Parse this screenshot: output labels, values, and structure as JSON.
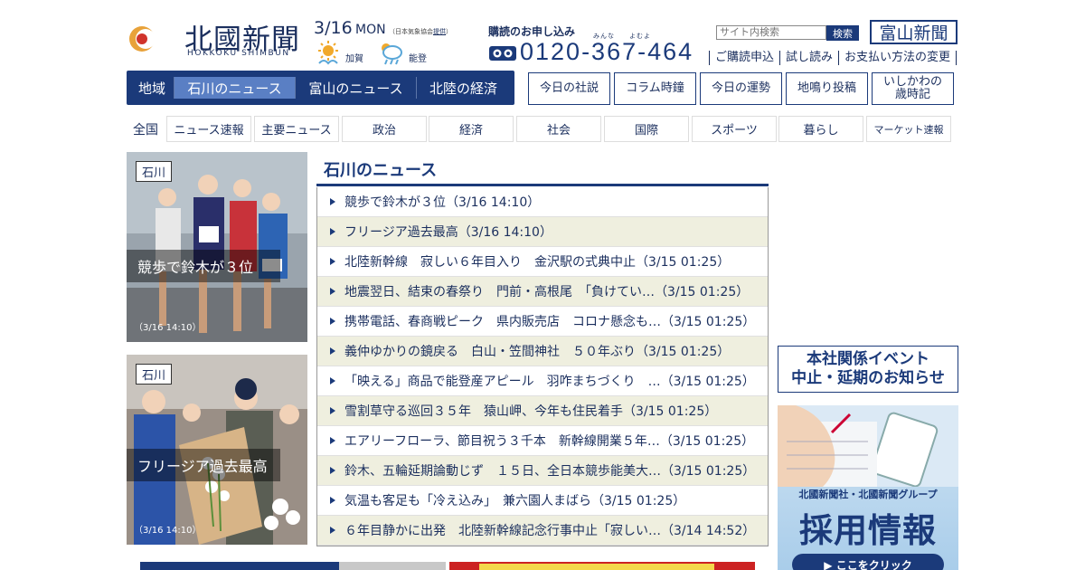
{
  "brand": {
    "name": "北國新聞",
    "name_en": "HOKKOKU SHIMBUN",
    "color": "#1b3a7a"
  },
  "weather": {
    "date": "3/16",
    "day": "MON",
    "source_prefix": "（日本気象協会",
    "source_link": "提供",
    "source_suffix": "）",
    "areas": [
      {
        "name": "加賀",
        "icon": "sun-icon"
      },
      {
        "name": "能登",
        "icon": "cloud-rain-icon"
      }
    ]
  },
  "subscribe": {
    "title": "購読のお申し込み",
    "ruby": "みんな　　よむよ",
    "phone": "0120-367-464",
    "links": [
      "ご購読申込",
      "試し読み",
      "お支払い方法の変更"
    ]
  },
  "search": {
    "placeholder": "サイト内検索",
    "button": "検索"
  },
  "toyama_logo": "富山新聞",
  "region_nav": {
    "label": "地域",
    "tabs": [
      {
        "label": "石川のニュース",
        "active": true
      },
      {
        "label": "富山のニュース",
        "active": false
      },
      {
        "label": "北陸の経済",
        "active": false
      }
    ]
  },
  "columns": [
    "今日の社説",
    "コラム時鐘",
    "今日の運勢",
    "地鳴り投稿",
    "いしかわの\n歳時記"
  ],
  "category_nav": {
    "label": "全国",
    "items": [
      "ニュース速報",
      "主要ニュース",
      "政治",
      "経済",
      "社会",
      "国際",
      "スポーツ",
      "暮らし",
      "マーケット速報"
    ]
  },
  "cards": [
    {
      "tag": "石川",
      "caption": "競歩で鈴木が３位",
      "time": "（3/16 14:10）"
    },
    {
      "tag": "石川",
      "caption": "フリージア過去最高",
      "time": "（3/16 14:10）"
    }
  ],
  "news": {
    "title": "石川のニュース",
    "items": [
      "競歩で鈴木が３位（3/16 14:10）",
      "フリージア過去最高（3/16 14:10）",
      "北陸新幹線　寂しい６年目入り　金沢駅の式典中止（3/15 01:25）",
      "地震翌日、結束の春祭り　門前・高根尾　「負けてい…（3/15 01:25）",
      "携帯電話、春商戦ピーク　県内販売店　コロナ懸念も…（3/15 01:25）",
      "義仲ゆかりの鏡戻る　白山・笠間神社　５０年ぶり（3/15 01:25）",
      "「映える」商品で能登産アピール　羽咋まちづくり　…（3/15 01:25）",
      "雪割草守る巡回３５年　猿山岬、今年も住民着手（3/15 01:25）",
      "エアリーフローラ、節目祝う３千本　新幹線開業５年…（3/15 01:25）",
      "鈴木、五輪延期論動じず　１５日、全日本競歩能美大…（3/15 01:25）",
      "気温も客足も「冷え込み」　兼六園人まばら（3/15 01:25）",
      "６年目静かに出発　北陸新幹線記念行事中止「寂しい…（3/14 14:52）"
    ]
  },
  "banners": {
    "event_line1": "本社関係イベント",
    "event_line2": "中止・延期のお知らせ",
    "recruit_top": "北國新聞社・北國新聞グループ",
    "recruit_main": "採用情報",
    "recruit_click": "▶ ここをクリック"
  }
}
